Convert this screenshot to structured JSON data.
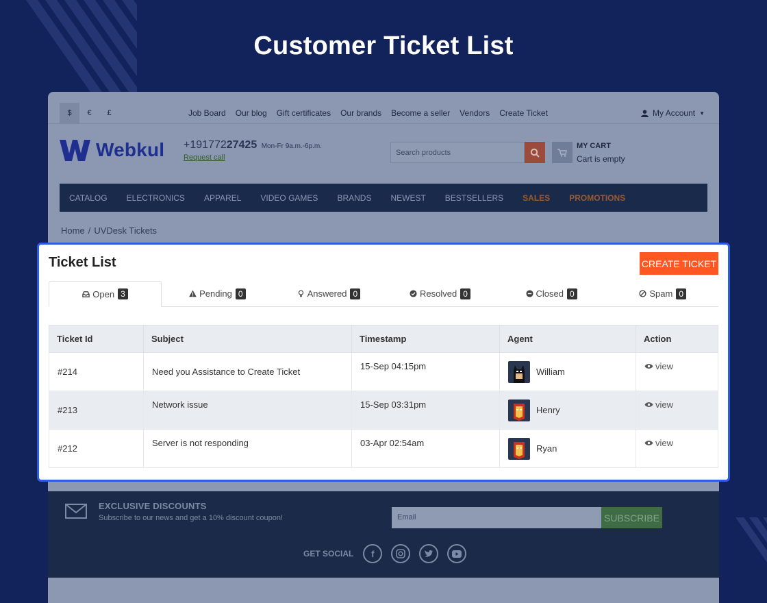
{
  "page_title": "Customer Ticket List",
  "store": {
    "currencies": [
      "$",
      "€",
      "£"
    ],
    "top_links": [
      "Job Board",
      "Our blog",
      "Gift certificates",
      "Our brands",
      "Become a seller",
      "Vendors",
      "Create Ticket"
    ],
    "account_label": "My Account",
    "logo_text": "Webkul",
    "phone_prefix": "+191772",
    "phone_bold": "27425",
    "phone_hours": "Mon-Fr 9a.m.-6p.m.",
    "request_call": "Request call",
    "search_placeholder": "Search products",
    "cart_title": "MY CART",
    "cart_status": "Cart is empty",
    "nav_items": [
      "CATALOG",
      "ELECTRONICS",
      "APPAREL",
      "VIDEO GAMES",
      "BRANDS",
      "NEWEST",
      "BESTSELLERS",
      "SALES",
      "PROMOTIONS"
    ],
    "breadcrumb": [
      "Home",
      "UVDesk Tickets"
    ]
  },
  "ticket_panel": {
    "title": "Ticket List",
    "create_button": "CREATE TICKET",
    "tabs": [
      {
        "label": "Open",
        "count": "3",
        "icon": "inbox-icon"
      },
      {
        "label": "Pending",
        "count": "0",
        "icon": "warning-icon"
      },
      {
        "label": "Answered",
        "count": "0",
        "icon": "lightbulb-icon"
      },
      {
        "label": "Resolved",
        "count": "0",
        "icon": "check-circle-icon"
      },
      {
        "label": "Closed",
        "count": "0",
        "icon": "minus-circle-icon"
      },
      {
        "label": "Spam",
        "count": "0",
        "icon": "ban-icon"
      }
    ],
    "columns": [
      "Ticket Id",
      "Subject",
      "Timestamp",
      "Agent",
      "Action"
    ],
    "rows": [
      {
        "id": "#214",
        "subject": "Need you Assistance to Create Ticket",
        "timestamp": "15-Sep 04:15pm",
        "agent": "William",
        "action": "view"
      },
      {
        "id": "#213",
        "subject": "Network issue",
        "timestamp": "15-Sep 03:31pm",
        "agent": "Henry",
        "action": "view"
      },
      {
        "id": "#212",
        "subject": "Server is not responding",
        "timestamp": "03-Apr 02:54am",
        "agent": "Ryan",
        "action": "view"
      }
    ]
  },
  "footer": {
    "discount_title": "EXCLUSIVE DISCOUNTS",
    "discount_text": "Subscribe to our news and get a 10% discount coupon!",
    "email_placeholder": "Email",
    "subscribe_label": "SUBSCRIBE",
    "social_label": "GET SOCIAL",
    "social_icons": [
      "facebook-icon",
      "instagram-icon",
      "twitter-icon",
      "youtube-icon"
    ]
  },
  "colors": {
    "background": "#12225a",
    "accent": "#ff5722",
    "card_border": "#2d5ce0"
  }
}
